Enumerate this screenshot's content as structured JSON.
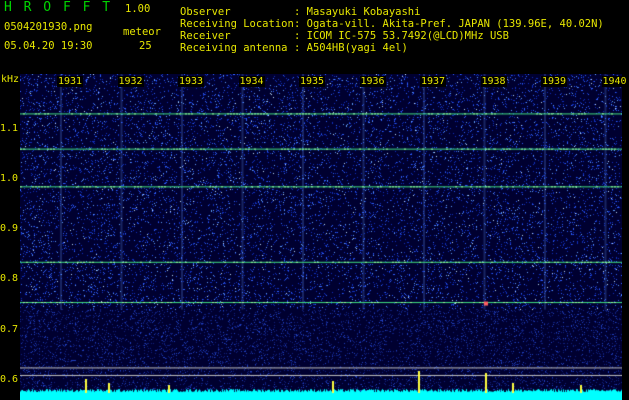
{
  "app": {
    "name": "H R O F F T",
    "version": "1.00"
  },
  "file": {
    "name": "0504201930.png",
    "datetime": "05.04.20 19:30"
  },
  "meteor": {
    "label": "meteor",
    "count": "25"
  },
  "info": [
    {
      "label": "Observer",
      "value": ": Masayuki Kobayashi"
    },
    {
      "label": "Receiving Location",
      "value": ": Ogata-vill. Akita-Pref. JAPAN (139.96E, 40.02N)"
    },
    {
      "label": "Receiver",
      "value": ": ICOM IC-575 53.7492(@LCD)MHz USB"
    },
    {
      "label": "Receiving antenna",
      "value": ": A504HB(yagi 4el)"
    }
  ],
  "yaxis": {
    "unit": "kHz",
    "ticks": [
      {
        "label": "1.1",
        "value": 1.1
      },
      {
        "label": "1.0",
        "value": 1.0
      },
      {
        "label": "0.9",
        "value": 0.9
      },
      {
        "label": "0.8",
        "value": 0.8
      },
      {
        "label": "0.7",
        "value": 0.7
      },
      {
        "label": "0.6",
        "value": 0.6
      }
    ]
  },
  "xaxis": {
    "minutes": [
      "1931",
      "1932",
      "1933",
      "1934",
      "1935",
      "1936",
      "1937",
      "1938",
      "1939",
      "1940"
    ]
  },
  "carriers_khz": [
    1.13,
    1.06,
    0.985,
    0.835,
    0.755
  ],
  "colors": {
    "text": "#e6e600",
    "title": "#00d400",
    "signal": "#00ffff"
  }
}
